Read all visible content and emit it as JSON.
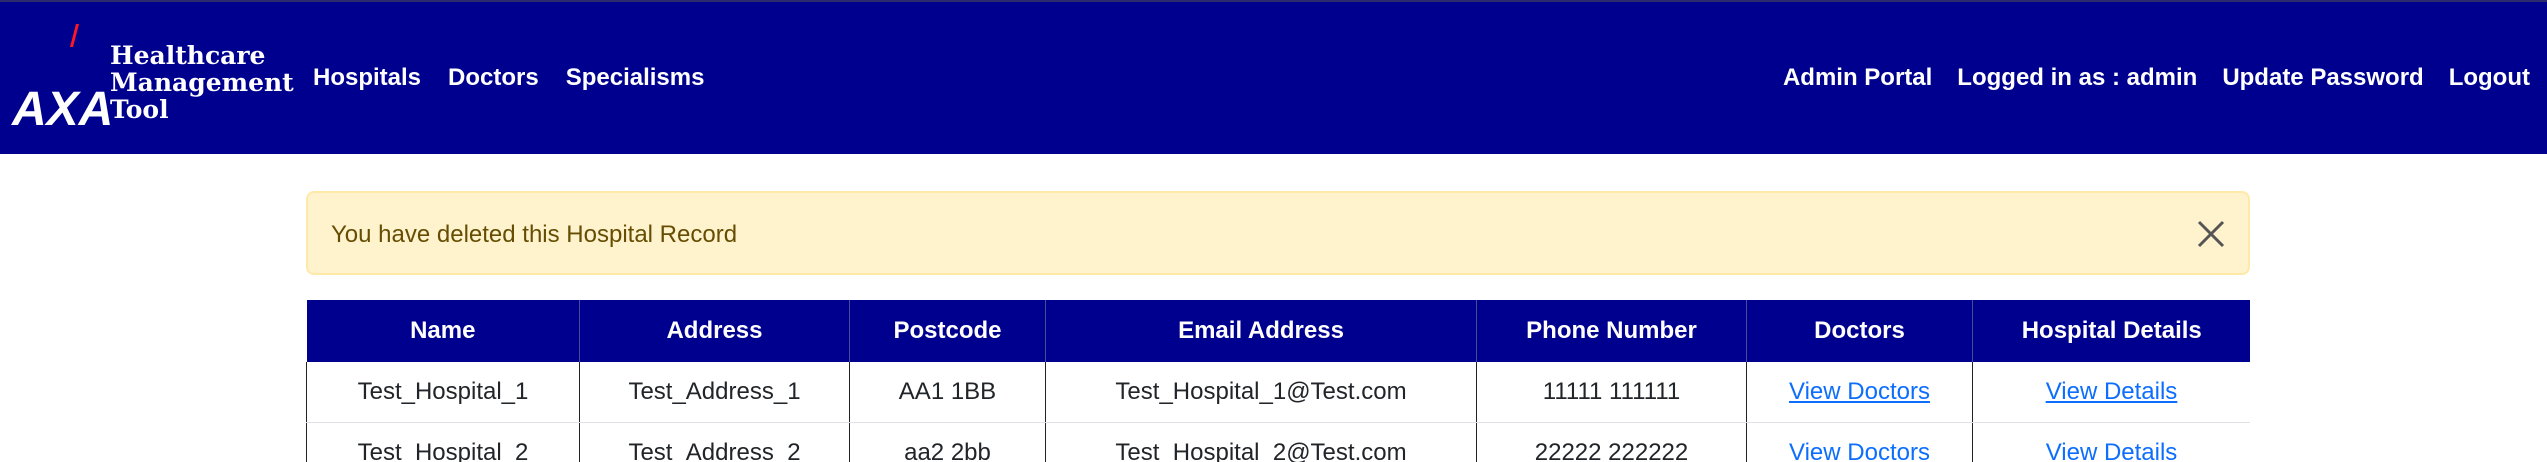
{
  "brand": {
    "logo_letters": "AXA",
    "title_lines": [
      "Healthcare",
      "Management",
      "Tool"
    ],
    "primary_color": "#00008f",
    "slash_color": "#ff1721"
  },
  "nav": {
    "left": [
      "Hospitals",
      "Doctors",
      "Specialisms"
    ],
    "right": [
      "Admin Portal",
      "Logged in as : admin",
      "Update Password",
      "Logout"
    ]
  },
  "alert": {
    "message": "You have deleted this Hospital Record",
    "close_icon": "close-icon"
  },
  "table": {
    "headers": [
      "Name",
      "Address",
      "Postcode",
      "Email Address",
      "Phone Number",
      "Doctors",
      "Hospital Details"
    ],
    "rows": [
      [
        "Test_Hospital_1",
        "Test_Address_1",
        "AA1 1BB",
        "Test_Hospital_1@Test.com",
        "11111 111111",
        "View Doctors",
        "View Details"
      ],
      [
        "Test_Hospital_2",
        "Test_Address_2",
        "aa2 2bb",
        "Test_Hospital_2@Test.com",
        "22222 222222",
        "View Doctors",
        "View Details"
      ]
    ]
  }
}
